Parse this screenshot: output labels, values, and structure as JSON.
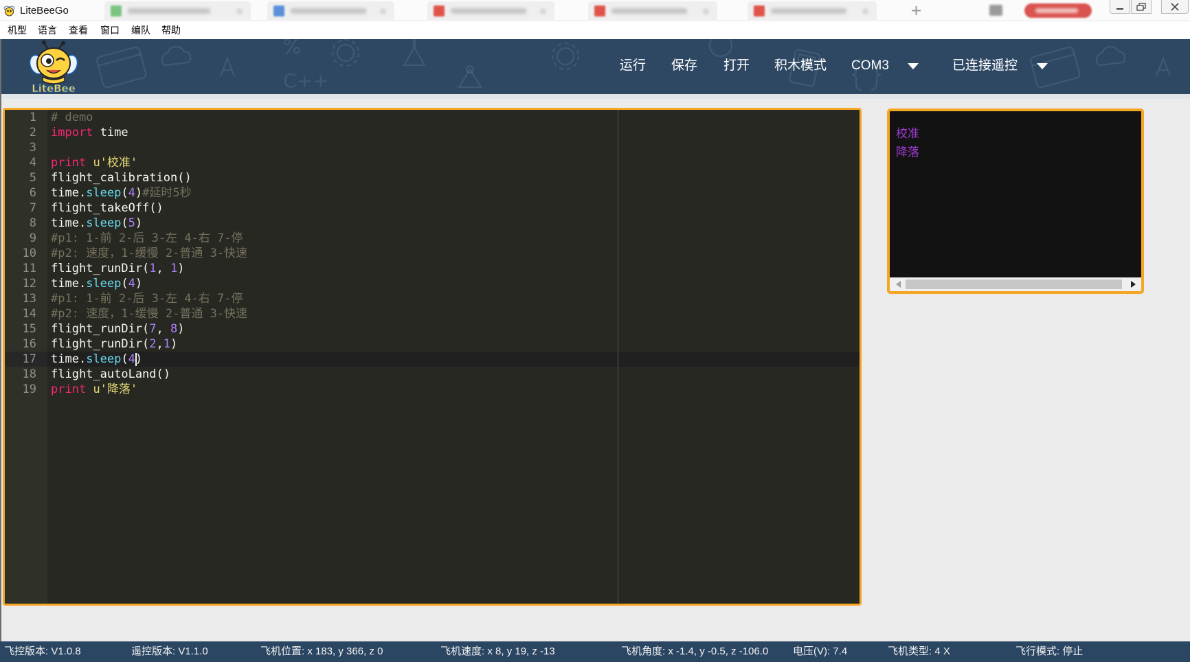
{
  "window": {
    "title": "LiteBeeGo",
    "app_icon": "bee-icon",
    "tabs": [
      {
        "icon": "document-icon",
        "color": "#7cc47f"
      },
      {
        "icon": "document-icon",
        "color": "#5b8fd9"
      },
      {
        "icon": "pdf-icon",
        "color": "#e0534a"
      },
      {
        "icon": "pdf-icon",
        "color": "#e0534a"
      },
      {
        "icon": "pdf-icon",
        "color": "#e0534a"
      }
    ],
    "controls": [
      "minimize-icon",
      "maximize-icon",
      "close-icon"
    ]
  },
  "menu": {
    "items": [
      "机型",
      "语言",
      "查看",
      "窗口",
      "编队",
      "帮助"
    ]
  },
  "header": {
    "logo_text": "LiteBee",
    "decor_text": "C++",
    "run": "运行",
    "save": "保存",
    "open": "打开",
    "block_mode": "积木模式",
    "port": "COM3",
    "remote": "已连接遥控",
    "dropdown_icon": "caret-down-icon",
    "background": "#2e4864"
  },
  "editor": {
    "active_line": 17,
    "cursor": {
      "line": 17,
      "column": 12
    },
    "lines": [
      {
        "n": "1",
        "tokens": [
          {
            "text": "# demo",
            "type": "comment"
          }
        ]
      },
      {
        "n": "2",
        "tokens": [
          {
            "text": "import",
            "type": "keyword"
          },
          {
            "text": " time",
            "type": "plain"
          }
        ]
      },
      {
        "n": "3",
        "tokens": []
      },
      {
        "n": "4",
        "tokens": [
          {
            "text": "print",
            "type": "keyword"
          },
          {
            "text": " ",
            "type": "plain"
          },
          {
            "text": "u'校准'",
            "type": "string"
          }
        ]
      },
      {
        "n": "5",
        "tokens": [
          {
            "text": "flight_calibration()",
            "type": "plain"
          }
        ]
      },
      {
        "n": "6",
        "tokens": [
          {
            "text": "time.",
            "type": "plain"
          },
          {
            "text": "sleep",
            "type": "function"
          },
          {
            "text": "(",
            "type": "plain"
          },
          {
            "text": "4",
            "type": "number"
          },
          {
            "text": ")",
            "type": "plain"
          },
          {
            "text": "#延时5秒",
            "type": "comment"
          }
        ]
      },
      {
        "n": "7",
        "tokens": [
          {
            "text": "flight_takeOff()",
            "type": "plain"
          }
        ]
      },
      {
        "n": "8",
        "tokens": [
          {
            "text": "time.",
            "type": "plain"
          },
          {
            "text": "sleep",
            "type": "function"
          },
          {
            "text": "(",
            "type": "plain"
          },
          {
            "text": "5",
            "type": "number"
          },
          {
            "text": ")",
            "type": "plain"
          }
        ]
      },
      {
        "n": "9",
        "tokens": [
          {
            "text": "#p1: 1-前 2-后 3-左 4-右 7-停",
            "type": "comment"
          }
        ]
      },
      {
        "n": "10",
        "tokens": [
          {
            "text": "#p2: 速度，1-缓慢 2-普通 3-快速",
            "type": "comment"
          }
        ]
      },
      {
        "n": "11",
        "tokens": [
          {
            "text": "flight_runDir(",
            "type": "plain"
          },
          {
            "text": "1",
            "type": "number"
          },
          {
            "text": ", ",
            "type": "plain"
          },
          {
            "text": "1",
            "type": "number"
          },
          {
            "text": ")",
            "type": "plain"
          }
        ]
      },
      {
        "n": "12",
        "tokens": [
          {
            "text": "time.",
            "type": "plain"
          },
          {
            "text": "sleep",
            "type": "function"
          },
          {
            "text": "(",
            "type": "plain"
          },
          {
            "text": "4",
            "type": "number"
          },
          {
            "text": ")",
            "type": "plain"
          }
        ]
      },
      {
        "n": "13",
        "tokens": [
          {
            "text": "#p1: 1-前 2-后 3-左 4-右 7-停",
            "type": "comment"
          }
        ]
      },
      {
        "n": "14",
        "tokens": [
          {
            "text": "#p2: 速度，1-缓慢 2-普通 3-快速",
            "type": "comment"
          }
        ]
      },
      {
        "n": "15",
        "tokens": [
          {
            "text": "flight_runDir(",
            "type": "plain"
          },
          {
            "text": "7",
            "type": "number"
          },
          {
            "text": ", ",
            "type": "plain"
          },
          {
            "text": "8",
            "type": "number"
          },
          {
            "text": ")",
            "type": "plain"
          }
        ]
      },
      {
        "n": "16",
        "tokens": [
          {
            "text": "flight_runDir(",
            "type": "plain"
          },
          {
            "text": "2",
            "type": "number"
          },
          {
            "text": ",",
            "type": "plain"
          },
          {
            "text": "1",
            "type": "number"
          },
          {
            "text": ")",
            "type": "plain"
          }
        ]
      },
      {
        "n": "17",
        "tokens": [
          {
            "text": "time.",
            "type": "plain"
          },
          {
            "text": "sleep",
            "type": "function"
          },
          {
            "text": "(",
            "type": "plain"
          },
          {
            "text": "4",
            "type": "number"
          },
          {
            "text": ")",
            "type": "plain"
          }
        ]
      },
      {
        "n": "18",
        "tokens": [
          {
            "text": "flight_autoLand()",
            "type": "plain"
          }
        ]
      },
      {
        "n": "19",
        "tokens": [
          {
            "text": "print",
            "type": "keyword"
          },
          {
            "text": " ",
            "type": "plain"
          },
          {
            "text": "u'降落'",
            "type": "string"
          }
        ]
      }
    ]
  },
  "console": {
    "lines": [
      "校准",
      "降落"
    ]
  },
  "status": {
    "fc_version": {
      "label": "飞控版本:",
      "value": "V1.0.8"
    },
    "rc_version": {
      "label": "遥控版本:",
      "value": "V1.1.0"
    },
    "position": {
      "label": "飞机位置:",
      "value": "x 183, y 366, z 0"
    },
    "velocity": {
      "label": "飞机速度:",
      "value": "x 8, y 19, z -13"
    },
    "attitude": {
      "label": "飞机角度:",
      "value": "x -1.4, y -0.5, z -106.0"
    },
    "voltage": {
      "label": "电压(V):",
      "value": "7.4"
    },
    "aircraft_type": {
      "label": "飞机类型:",
      "value": "4 X"
    },
    "flight_mode": {
      "label": "飞行模式:",
      "value": "停止"
    }
  },
  "colors": {
    "accent_border": "#f5a623",
    "header_bg": "#2e4864",
    "status_bg": "#2b4662",
    "console_text": "#a23bd6",
    "editor_bg": "#272822",
    "gutter_bg": "#2f3129",
    "line_number": "#8f908a",
    "syntax": {
      "plain": "#f8f8f2",
      "keyword": "#f92672",
      "string": "#e6db74",
      "function": "#66d9ef",
      "number": "#ae81ff",
      "comment": "#75715e"
    }
  }
}
